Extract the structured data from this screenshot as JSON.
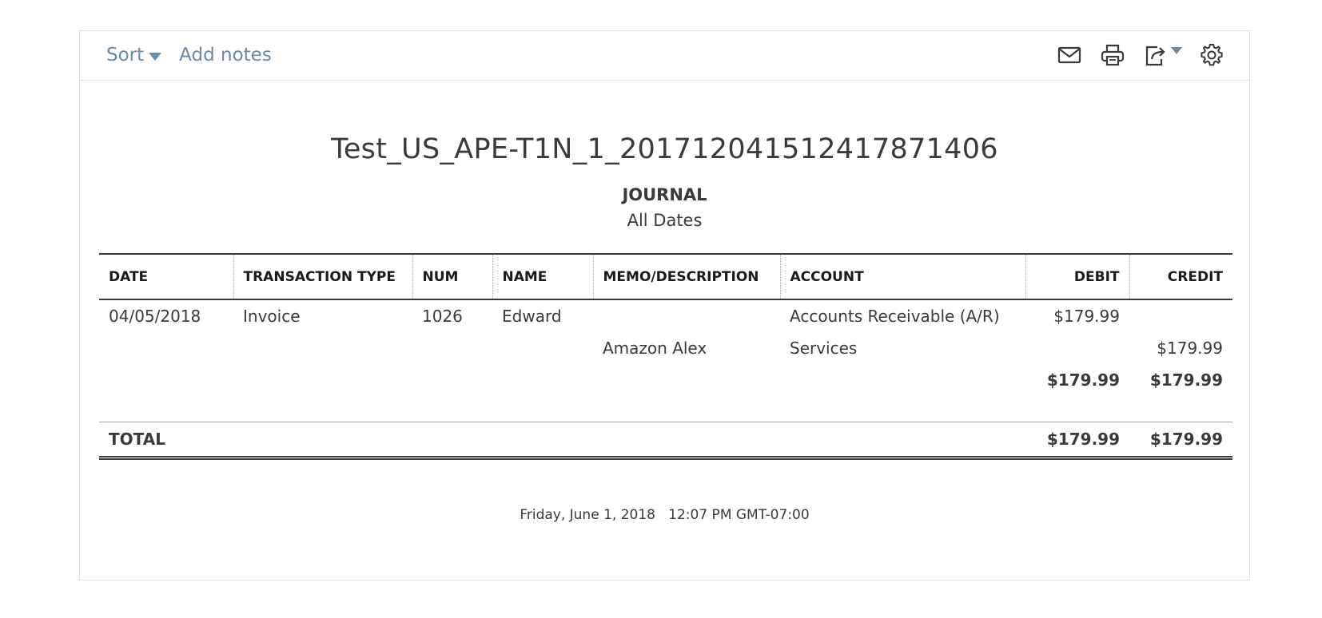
{
  "toolbar": {
    "sort_label": "Sort",
    "add_notes_label": "Add notes",
    "icons": [
      "email-icon",
      "print-icon",
      "export-icon",
      "settings-icon"
    ],
    "accent_color": "#6b8aa6"
  },
  "report": {
    "company": "Test_US_APE-T1N_1_20171204151241787140​6",
    "name": "JOURNAL",
    "period": "All Dates"
  },
  "table": {
    "columns": [
      "DATE",
      "TRANSACTION TYPE",
      "NUM",
      "NAME",
      "MEMO/DESCRIPTION",
      "ACCOUNT",
      "DEBIT",
      "CREDIT"
    ],
    "rows": [
      {
        "date": "04/05/2018",
        "type": "Invoice",
        "num": "1026",
        "name": "Edward",
        "memo": "",
        "account": "Accounts Receivable (A/R)",
        "debit": "$179.99",
        "credit": ""
      },
      {
        "date": "",
        "type": "",
        "num": "",
        "name": "",
        "memo": "Amazon Alex",
        "account": "Services",
        "debit": "",
        "credit": "$179.99"
      }
    ],
    "subtotal": {
      "debit": "$179.99",
      "credit": "$179.99"
    },
    "total": {
      "label": "TOTAL",
      "debit": "$179.99",
      "credit": "$179.99"
    }
  },
  "footer": {
    "timestamp": "Friday, June 1, 2018   12:07 PM GMT-07:00"
  }
}
